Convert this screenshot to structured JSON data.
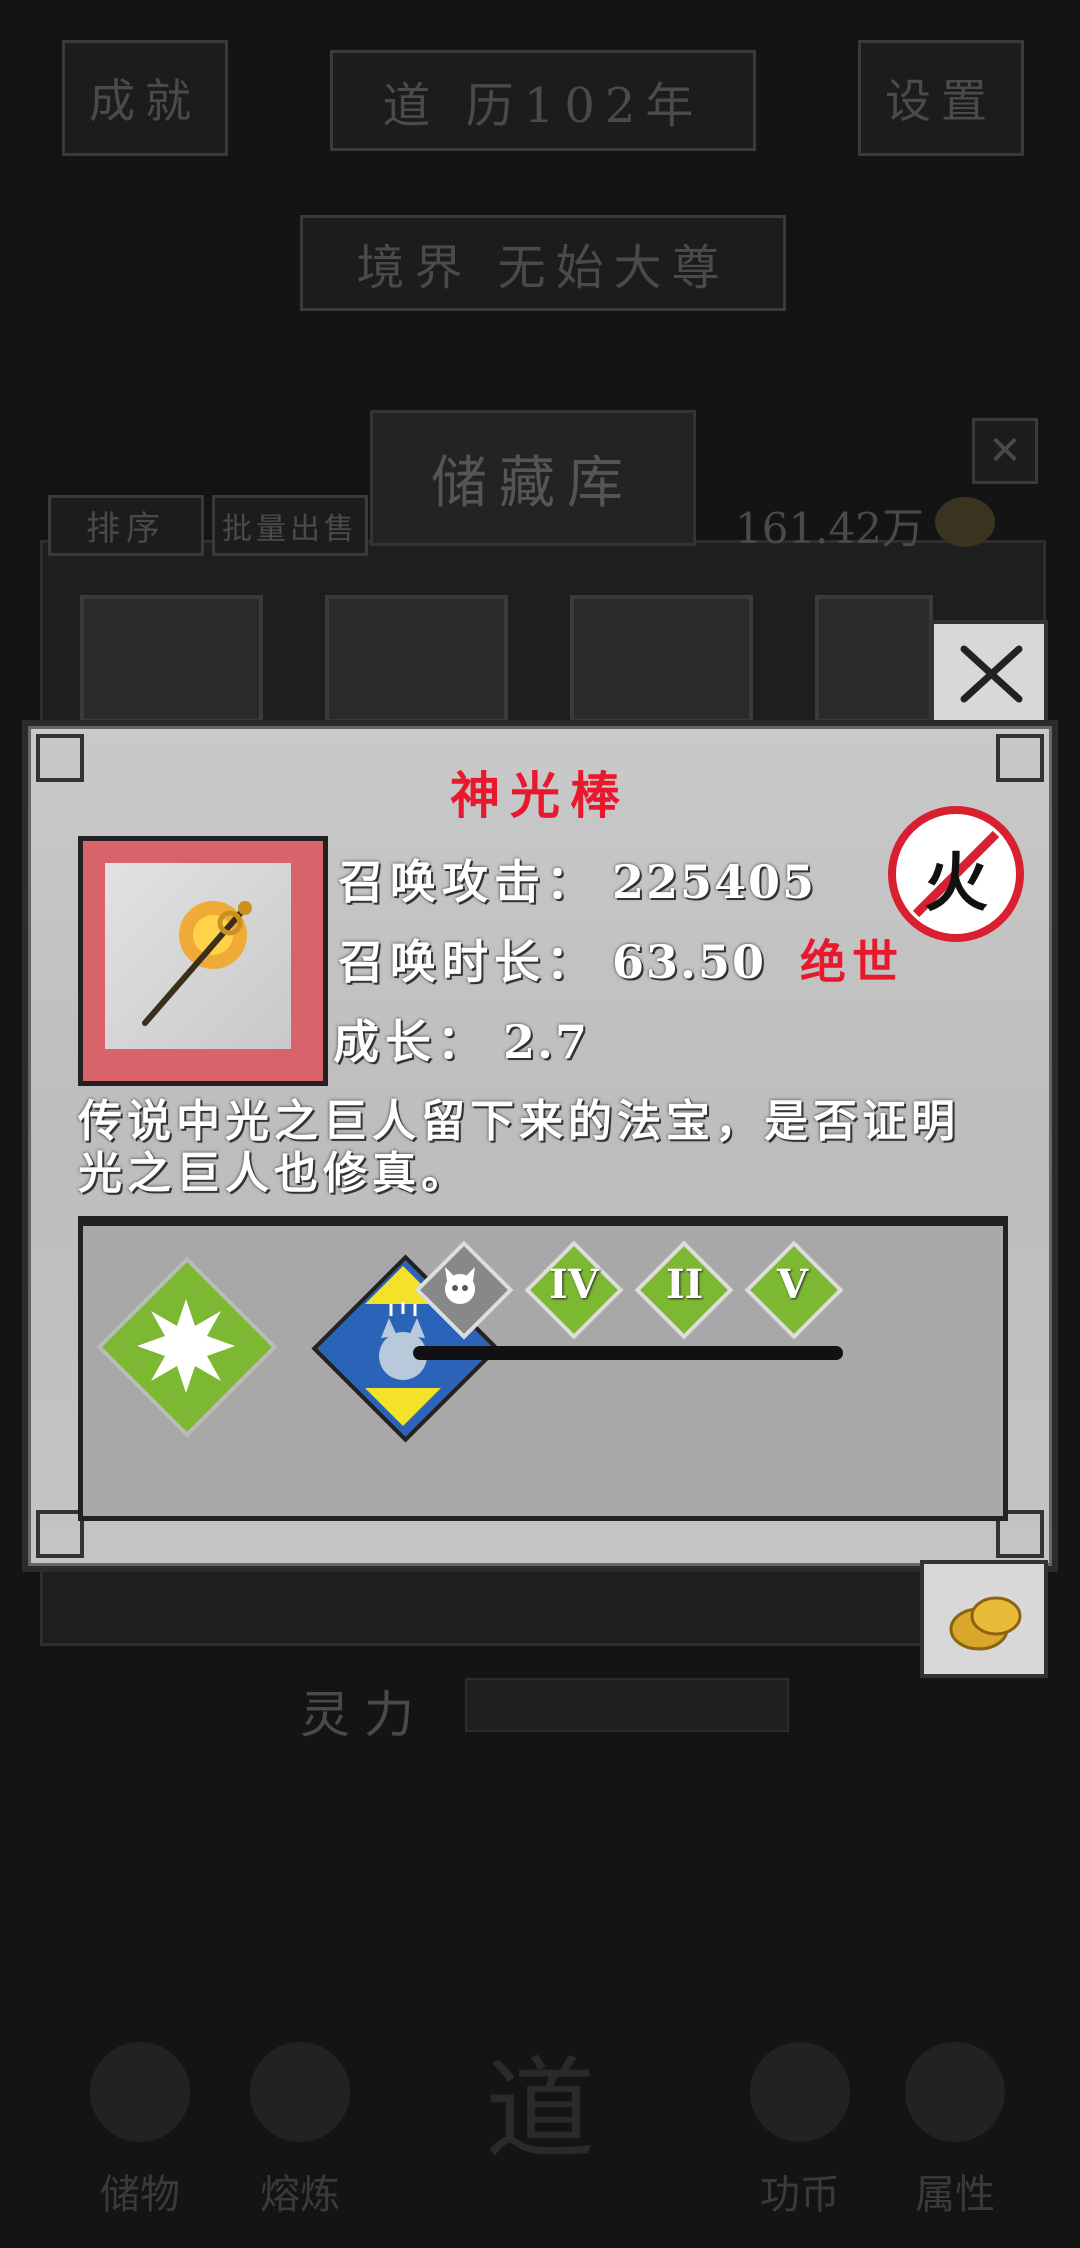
{
  "header": {
    "achievements_label": "成就",
    "year_label": "道 历102年",
    "settings_label": "设置",
    "realm_label": "境界 无始大尊"
  },
  "storage": {
    "title": "储藏库",
    "sort_label": "排序",
    "bulk_sell_label": "批量出售",
    "currency_amount": "161.42万",
    "close_icon": "close-icon"
  },
  "bottom_nav": {
    "items": [
      {
        "label": "储物",
        "icon": "bag-icon"
      },
      {
        "label": "熔炼",
        "icon": "furnace-icon"
      },
      {
        "label": "道",
        "icon": "dao-icon"
      },
      {
        "label": "功币",
        "icon": "coin-stack-icon"
      },
      {
        "label": "属性",
        "icon": "yin-yang-icon"
      }
    ],
    "power_label": "灵力"
  },
  "modal": {
    "item_name": "神光棒",
    "item_icon": "flaming-staff-icon",
    "element_icon": "fire-element-icon",
    "element_char": "火",
    "stats": {
      "attack_label": "召唤攻击：",
      "attack_value": "225405",
      "duration_label": "召唤时长：",
      "duration_value": "63.50",
      "grade": "绝世",
      "growth_label": "成长：",
      "growth_value": "2.7"
    },
    "description": "传说中光之巨人留下来的法宝，是否证明光之巨人也修真。",
    "skills": {
      "primary_icon": "burst-icon",
      "secondary_icon": "wolf-buff-icon",
      "small": [
        {
          "icon": "demon-skull-icon",
          "label": ""
        },
        {
          "icon": "rune-icon",
          "label": "IV"
        },
        {
          "icon": "rune-icon",
          "label": "II"
        },
        {
          "icon": "rune-icon",
          "label": "V"
        }
      ]
    },
    "colors": {
      "item_name": "#e8192c",
      "grade": "#e8192c",
      "skill_green": "#7cb832",
      "skill_blue": "#2a63b8",
      "skill_yellow": "#f4e12a",
      "item_frame": "#d9636b"
    }
  }
}
